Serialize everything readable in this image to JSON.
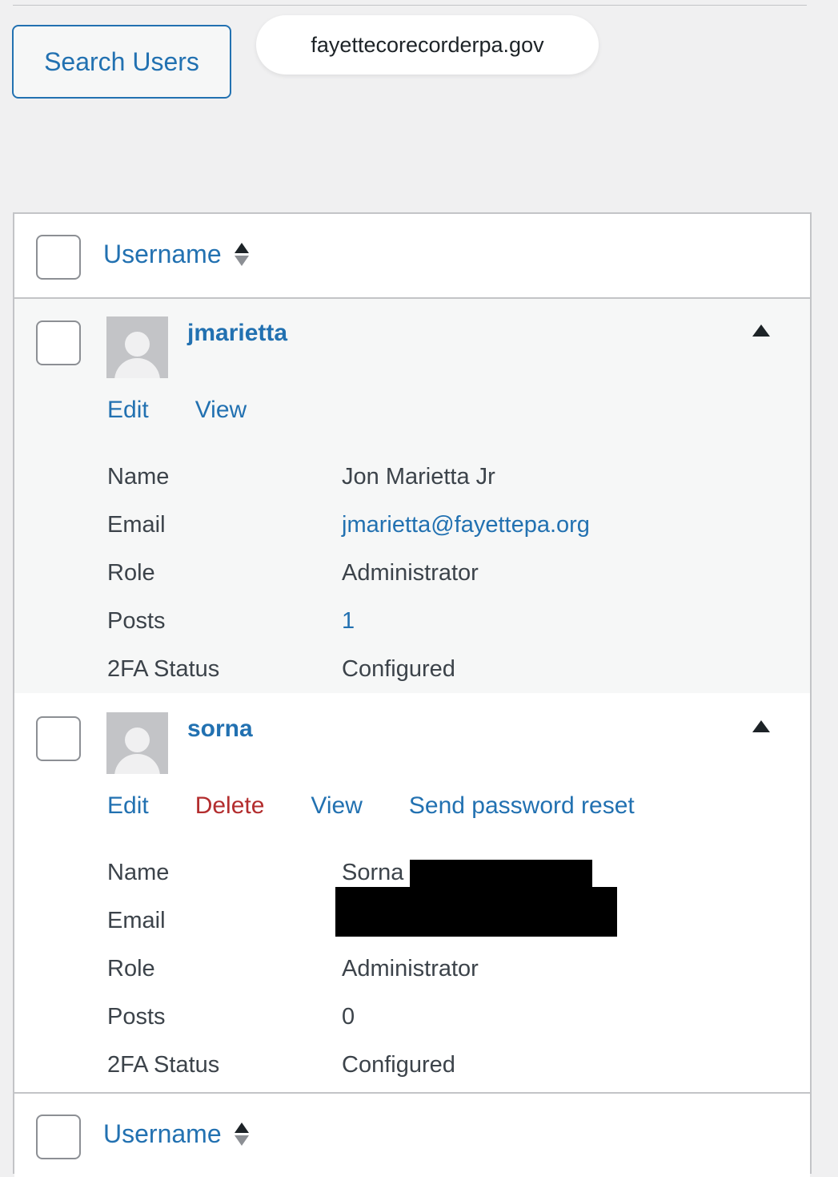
{
  "toolbar": {
    "search_button_label": "Search Users"
  },
  "address_bar": {
    "url": "fayettecorecorderpa.gov"
  },
  "table": {
    "column_header": "Username",
    "column_footer": "Username",
    "rows": [
      {
        "username": "jmarietta",
        "actions": [
          "Edit",
          "View"
        ],
        "fields": {
          "name_label": "Name",
          "name": "Jon Marietta Jr",
          "email_label": "Email",
          "email": "jmarietta@fayettepa.org",
          "role_label": "Role",
          "role": "Administrator",
          "posts_label": "Posts",
          "posts": "1",
          "twofa_label": "2FA Status",
          "twofa": "Configured"
        }
      },
      {
        "username": "sorna",
        "actions": [
          "Edit",
          "Delete",
          "View",
          "Send password reset"
        ],
        "fields": {
          "name_label": "Name",
          "name": "Sorna",
          "email_label": "Email",
          "email": "",
          "role_label": "Role",
          "role": "Administrator",
          "posts_label": "Posts",
          "posts": "0",
          "twofa_label": "2FA Status",
          "twofa": "Configured"
        }
      }
    ]
  },
  "colors": {
    "link": "#2271b1",
    "delete": "#b32d2e",
    "text": "#3c434a",
    "background": "#f0f0f1"
  }
}
